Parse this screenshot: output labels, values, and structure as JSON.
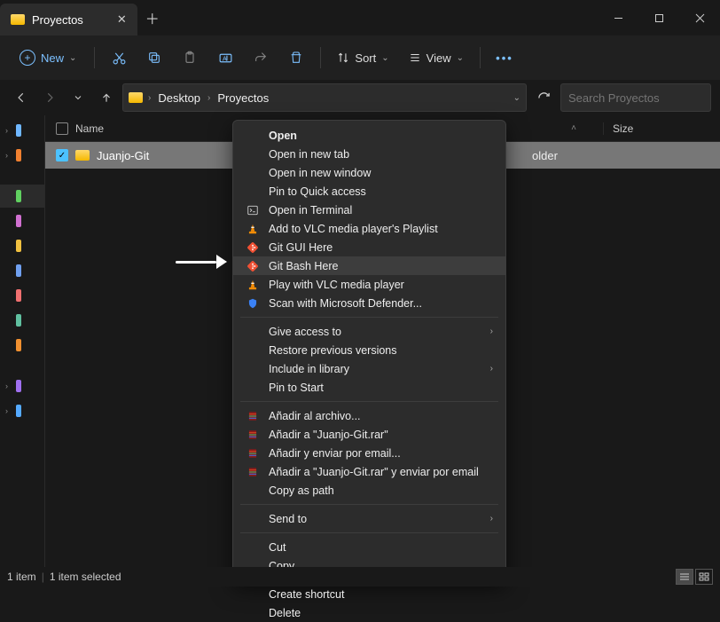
{
  "window": {
    "tab_title": "Proyectos"
  },
  "toolbar": {
    "new_label": "New",
    "sort_label": "Sort",
    "view_label": "View"
  },
  "breadcrumb": {
    "items": [
      "Desktop",
      "Proyectos"
    ]
  },
  "search": {
    "placeholder": "Search Proyectos"
  },
  "columns": {
    "name": "Name",
    "size": "Size"
  },
  "rows": [
    {
      "name": "Juanjo-Git",
      "type_partial": "older"
    }
  ],
  "rail_colors": [
    "#6fb7ff",
    "#f08030",
    "#60d060",
    "#d070d0",
    "#f0c040",
    "#70a0f0",
    "#f07070",
    "#60c0a0",
    "#f09030",
    "#a070f0",
    "#55aaff"
  ],
  "context_menu": {
    "groups": [
      [
        {
          "label": "Open",
          "bold": true,
          "icon": null
        },
        {
          "label": "Open in new tab",
          "icon": null
        },
        {
          "label": "Open in new window",
          "icon": null
        },
        {
          "label": "Pin to Quick access",
          "icon": null
        },
        {
          "label": "Open in Terminal",
          "icon": "terminal"
        },
        {
          "label": "Add to VLC media player's Playlist",
          "icon": "vlc"
        },
        {
          "label": "Git GUI Here",
          "icon": "git"
        },
        {
          "label": "Git Bash Here",
          "icon": "git",
          "highlight": true
        },
        {
          "label": "Play with VLC media player",
          "icon": "vlc"
        },
        {
          "label": "Scan with Microsoft Defender...",
          "icon": "shield"
        }
      ],
      [
        {
          "label": "Give access to",
          "icon": null,
          "submenu": true
        },
        {
          "label": "Restore previous versions",
          "icon": null
        },
        {
          "label": "Include in library",
          "icon": null,
          "submenu": true
        },
        {
          "label": "Pin to Start",
          "icon": null
        }
      ],
      [
        {
          "label": "Añadir al archivo...",
          "icon": "rar"
        },
        {
          "label": "Añadir a \"Juanjo-Git.rar\"",
          "icon": "rar"
        },
        {
          "label": "Añadir y enviar por email...",
          "icon": "rar"
        },
        {
          "label": "Añadir a \"Juanjo-Git.rar\" y enviar por email",
          "icon": "rar"
        },
        {
          "label": "Copy as path",
          "icon": null
        }
      ],
      [
        {
          "label": "Send to",
          "icon": null,
          "submenu": true
        }
      ],
      [
        {
          "label": "Cut",
          "icon": null
        },
        {
          "label": "Copy",
          "icon": null
        }
      ],
      [
        {
          "label": "Create shortcut",
          "icon": null
        },
        {
          "label": "Delete",
          "icon": null
        }
      ]
    ]
  },
  "status": {
    "count": "1 item",
    "selected": "1 item selected"
  }
}
